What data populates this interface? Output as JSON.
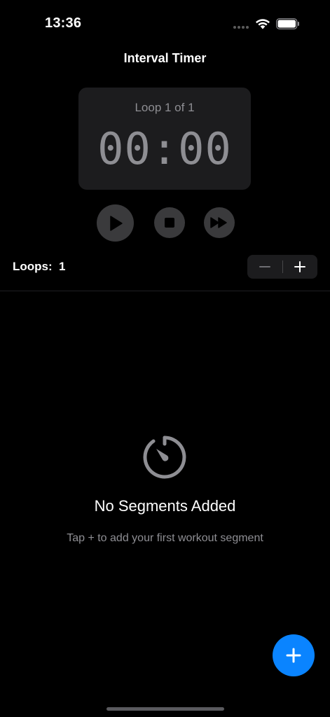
{
  "status_bar": {
    "time": "13:36"
  },
  "nav": {
    "title": "Interval Timer"
  },
  "timer": {
    "loop_label": "Loop 1 of 1",
    "time": "00:00"
  },
  "controls": {
    "play_icon": "play-icon",
    "stop_icon": "stop-icon",
    "skip_icon": "fast-forward-icon"
  },
  "loops": {
    "label": "Loops:",
    "value": "1",
    "decrement_icon": "minus-icon",
    "increment_icon": "plus-icon"
  },
  "empty_state": {
    "icon": "timer-icon",
    "title": "No Segments Added",
    "subtitle": "Tap + to add your first workout segment"
  },
  "fab": {
    "icon": "plus-icon"
  },
  "colors": {
    "background": "#000000",
    "card": "#1c1c1e",
    "control": "#3a3a3c",
    "secondary_text": "#8e8e93",
    "accent": "#0a84ff"
  }
}
